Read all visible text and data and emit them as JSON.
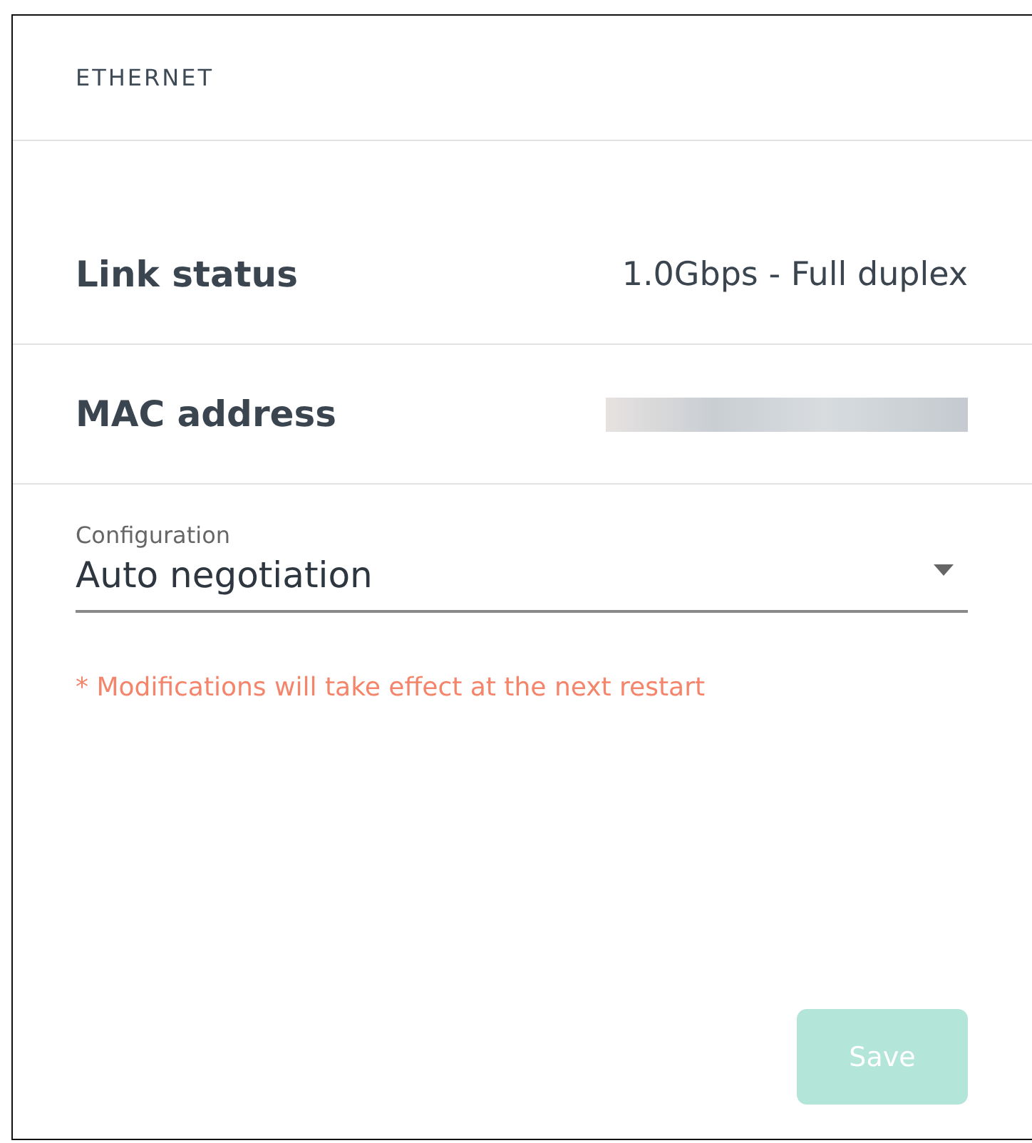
{
  "panel": {
    "title": "ETHERNET"
  },
  "info_rows": [
    {
      "kind": "text",
      "label": "Link status",
      "value": "1.0Gbps - Full duplex"
    },
    {
      "kind": "redacted",
      "label": "MAC address"
    }
  ],
  "configuration": {
    "label": "Configuration",
    "value": "Auto negotiation"
  },
  "note": "* Modifications will take effect at the next restart",
  "save_button": {
    "label": "Save",
    "disabled": true
  }
}
